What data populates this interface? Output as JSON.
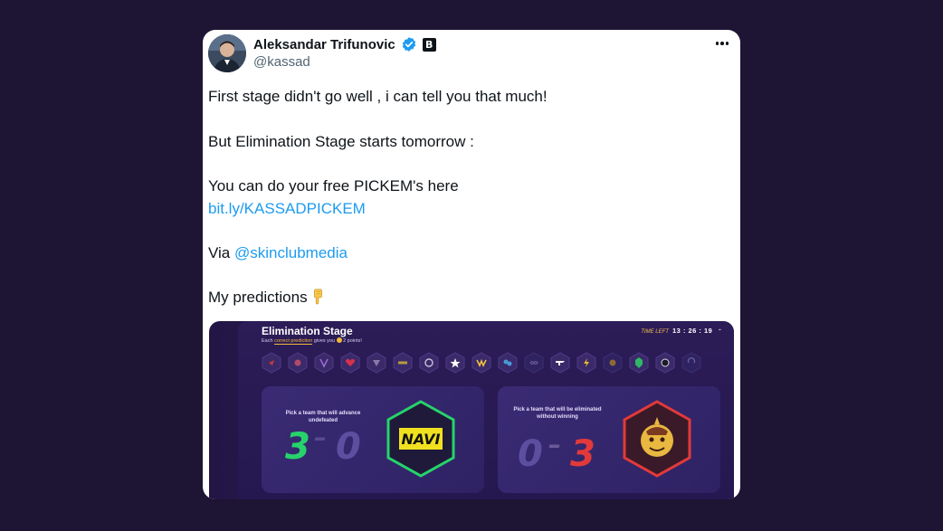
{
  "author": {
    "name": "Aleksandar Trifunovic",
    "handle": "@kassad",
    "affiliate_badge": "B"
  },
  "icons": {
    "avatar": "avatar-photo",
    "verified": "verified-badge-icon",
    "more": "more-options-icon",
    "emoji": "pointing-down-emoji"
  },
  "tweet": {
    "line1": "First stage didn't go well , i can tell you that much!",
    "line2": "But Elimination Stage starts tomorrow :",
    "line3": "You can do your free PICKEM's here",
    "link": "bit.ly/KASSADPICKEM",
    "via_prefix": "Via ",
    "mention": "@skinclubmedia",
    "line5": "My predictions"
  },
  "media": {
    "title": "Elimination Stage",
    "sub_prefix": "Each ",
    "sub_highlight": "correct prediction",
    "sub_mid": " gives you ",
    "sub_suffix": " 2 points!",
    "time_label": "TIME LEFT",
    "time_value": "13 : 26 : 19",
    "time_chevron": "^",
    "left_panel": {
      "label": "Pick a team that will advance undefeated",
      "score_win": "3",
      "score_dash": "–",
      "score_loss": "0",
      "team_logo_text": "NAVI"
    },
    "right_panel": {
      "label": "Pick a team that will be eliminated without winning",
      "score_win": "0",
      "score_dash": "–",
      "score_loss": "3"
    }
  },
  "colors": {
    "link": "#1d9bf0",
    "page_bg": "#1e1433",
    "green": "#26d36b",
    "red": "#e23a3a",
    "gold": "#f0b83a"
  }
}
